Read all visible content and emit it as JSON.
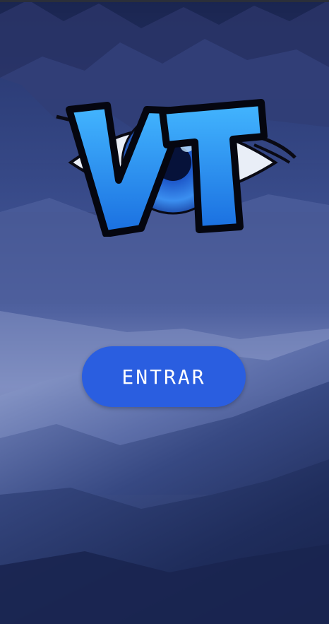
{
  "logo": {
    "letters": "VT",
    "icon": "eye-icon"
  },
  "enter_button": {
    "label": "ENTRAR"
  },
  "colors": {
    "button_background": "#2a5ee0",
    "logo_blue": "#2f9ef2",
    "sky_dark": "#0f1a3a",
    "mountain_light": "#8fa2d2"
  }
}
